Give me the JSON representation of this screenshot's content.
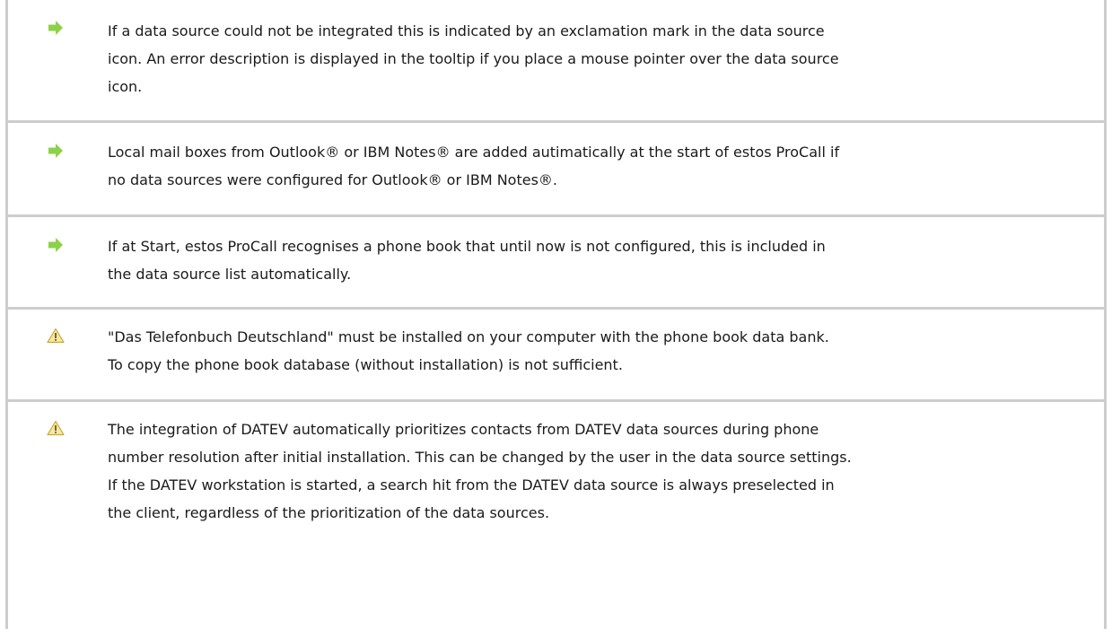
{
  "notes": [
    {
      "type": "tip",
      "icon": "arrow-right-icon",
      "lines": [
        "If a data source could not be integrated this is indicated by an exclamation mark in the data source",
        "icon. An error description is displayed in the tooltip if you place a mouse pointer over the data source",
        "icon."
      ]
    },
    {
      "type": "tip",
      "icon": "arrow-right-icon",
      "lines": [
        "Local mail boxes from Outlook® or IBM Notes® are added autimatically at the start of estos ProCall if",
        "no data sources were configured for Outlook® or IBM Notes®."
      ]
    },
    {
      "type": "tip",
      "icon": "arrow-right-icon",
      "lines": [
        "If at Start, estos ProCall recognises a phone book that until now is not configured, this is included in",
        "the data source list automatically."
      ]
    },
    {
      "type": "warning",
      "icon": "warning-icon",
      "lines": [
        "\"Das Telefonbuch Deutschland\" must be installed on your computer with the phone book data bank.",
        "To copy the phone book database (without installation) is not sufficient."
      ]
    },
    {
      "type": "warning",
      "icon": "warning-icon",
      "lines": [
        "The integration of DATEV automatically prioritizes contacts from DATEV data sources during phone",
        "number resolution after initial installation. This can be changed by the user in the data source settings.",
        "If the DATEV workstation is started, a search hit from the DATEV data source is always preselected in",
        "the client, regardless of the prioritization of the data sources."
      ]
    }
  ],
  "colors": {
    "arrow": "#8dd14a",
    "warning_fill": "#f6e8a6",
    "warning_stroke": "#c9a833",
    "border": "#cdcdcd"
  }
}
